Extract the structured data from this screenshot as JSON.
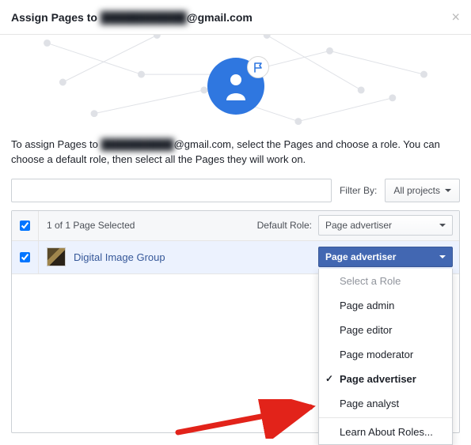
{
  "header": {
    "title_prefix": "Assign Pages to ",
    "email_obscured": "███████████",
    "email_domain": "@gmail.com"
  },
  "intro": {
    "part1": "To assign Pages to ",
    "email_obscured": "██████████",
    "email_domain": "@gmail.com",
    "part2": ", select the Pages and choose a role. You can choose a default role, then select all the Pages they will work on."
  },
  "filter": {
    "label": "Filter By:",
    "projects_button": "All projects",
    "search_placeholder": ""
  },
  "table": {
    "count_text": "1 of 1 Page Selected",
    "default_role_label": "Default Role:",
    "default_role_value": "Page advertiser",
    "rows": [
      {
        "name": "Digital Image Group",
        "role": "Page advertiser"
      }
    ]
  },
  "menu": {
    "placeholder": "Select a Role",
    "options": [
      "Page admin",
      "Page editor",
      "Page moderator",
      "Page advertiser",
      "Page analyst"
    ],
    "selected": "Page advertiser",
    "learn": "Learn About Roles..."
  }
}
